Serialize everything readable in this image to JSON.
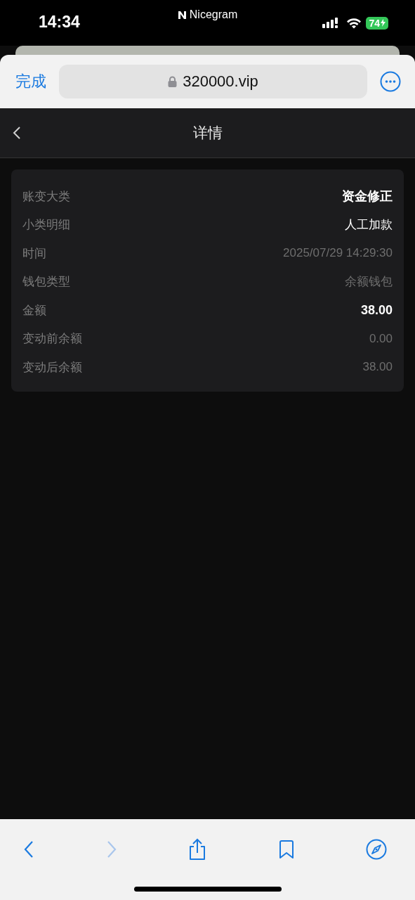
{
  "status_bar": {
    "time": "14:34",
    "app_label": "Nicegram",
    "battery": "74"
  },
  "browser_bar": {
    "done": "完成",
    "url": "320000.vip"
  },
  "page_header": {
    "title": "详情"
  },
  "details": [
    {
      "label": "账变大类",
      "value": "资金修正",
      "kind": "bold"
    },
    {
      "label": "小类明细",
      "value": "人工加款",
      "kind": "plain"
    },
    {
      "label": "时间",
      "value": "2025/07/29 14:29:30",
      "kind": "muted"
    },
    {
      "label": "钱包类型",
      "value": "余额钱包",
      "kind": "muted"
    },
    {
      "label": "金额",
      "value": "38.00",
      "kind": "bold"
    },
    {
      "label": "变动前余额",
      "value": "0.00",
      "kind": "muted"
    },
    {
      "label": "变动后余额",
      "value": "38.00",
      "kind": "muted"
    }
  ],
  "toolbar": {
    "forward_disabled": true
  }
}
